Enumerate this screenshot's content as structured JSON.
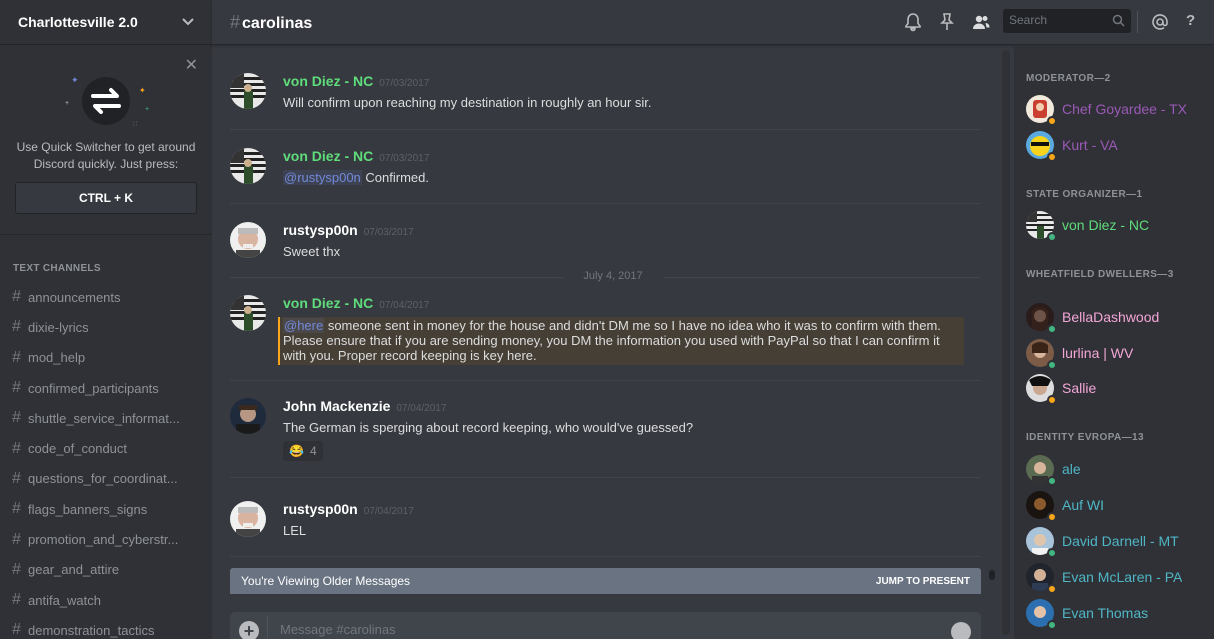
{
  "server": {
    "name": "Charlottesville 2.0"
  },
  "quick_switcher": {
    "text": "Use Quick Switcher to get around Discord quickly. Just press:",
    "shortcut": "CTRL + K"
  },
  "sidebar": {
    "channels_header": "TEXT CHANNELS",
    "channels": [
      "announcements",
      "dixie-lyrics",
      "mod_help",
      "confirmed_participants",
      "shuttle_service_informat...",
      "code_of_conduct",
      "questions_for_coordinat...",
      "flags_banners_signs",
      "promotion_and_cyberstr...",
      "gear_and_attire",
      "antifa_watch",
      "demonstration_tactics"
    ]
  },
  "header": {
    "channel": "carolinas",
    "search_placeholder": "Search"
  },
  "messages": [
    {
      "author": "von Diez - NC",
      "timestamp": "07/03/2017",
      "text": "Will confirm upon reaching my destination in roughly an hour sir."
    },
    {
      "author": "von Diez - NC",
      "timestamp": "07/03/2017",
      "mention": "@rustysp00n",
      "text": " Confirmed."
    },
    {
      "author": "rustysp00n",
      "timestamp": "07/03/2017",
      "text": "Sweet thx"
    },
    {
      "author": "von Diez - NC",
      "timestamp": "07/04/2017",
      "mention": "@here",
      "text": "  someone sent in money for the house and didn't DM me so I have no idea who it was to confirm with them. Please ensure that if you are sending money, you DM the information you used with PayPal so that I can confirm it with you. Proper record keeping is key here."
    },
    {
      "author": "John Mackenzie",
      "timestamp": "07/04/2017",
      "text": "The German is sperging about record keeping, who would've guessed?",
      "reaction": {
        "emoji": "😂",
        "count": "4"
      }
    },
    {
      "author": "rustysp00n",
      "timestamp": "07/04/2017",
      "text": "LEL"
    }
  ],
  "date_divider": "July 4, 2017",
  "older_bar": {
    "text": "You're Viewing Older Messages",
    "jump": "JUMP TO PRESENT"
  },
  "composer": {
    "placeholder": "Message #carolinas"
  },
  "members": {
    "groups": [
      {
        "title": "MODERATOR—2",
        "members": [
          {
            "name": "Chef Goyardee - TX",
            "color": "#9b59b6",
            "status": "#faa61a"
          },
          {
            "name": "Kurt - VA",
            "color": "#9b59b6",
            "status": "#faa61a"
          }
        ]
      },
      {
        "title": "STATE ORGANIZER—1",
        "members": [
          {
            "name": "von Diez - NC",
            "color": "#5fdc7b",
            "status": "#43b581"
          }
        ]
      },
      {
        "title": "WHEATFIELD DWELLERS—3",
        "members": [
          {
            "name": "BellaDashwood",
            "color": "#f4a6d7",
            "status": "#43b581"
          },
          {
            "name": "lurlina | WV",
            "color": "#f4a6d7",
            "status": "#43b581"
          },
          {
            "name": "Sallie",
            "color": "#f4a6d7",
            "status": "#faa61a"
          }
        ]
      },
      {
        "title": "IDENTITY EVROPA—13",
        "members": [
          {
            "name": "ale",
            "color": "#4fb6c5",
            "status": "#43b581"
          },
          {
            "name": "Auf WI",
            "color": "#4fb6c5",
            "status": "#faa61a"
          },
          {
            "name": "David Darnell - MT",
            "color": "#4fb6c5",
            "status": "#43b581"
          },
          {
            "name": "Evan McLaren - PA",
            "color": "#4fb6c5",
            "status": "#faa61a"
          },
          {
            "name": "Evan Thomas",
            "color": "#4fb6c5",
            "status": "#43b581"
          }
        ]
      }
    ]
  }
}
